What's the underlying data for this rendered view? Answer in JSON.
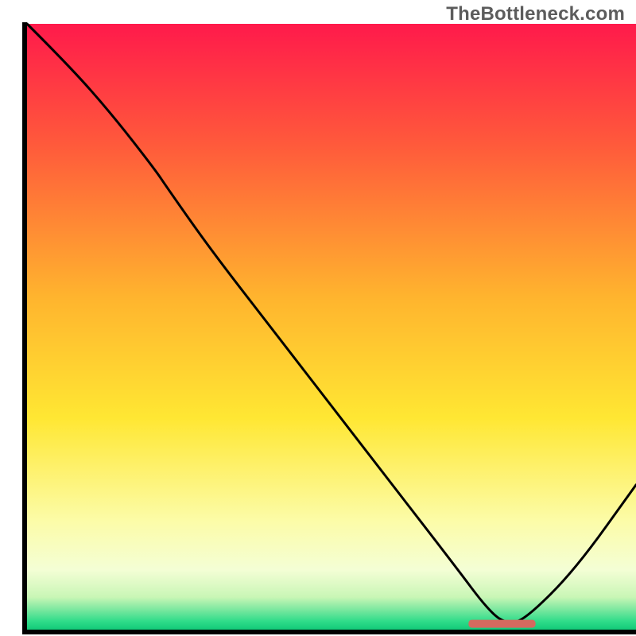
{
  "watermark": "TheBottleneck.com",
  "chart_data": {
    "type": "line",
    "title": "",
    "xlabel": "",
    "ylabel": "",
    "xlim": [
      0,
      100
    ],
    "ylim": [
      0,
      100
    ],
    "grid": false,
    "legend": false,
    "annotations": [],
    "background": {
      "type": "vertical_gradient",
      "stops": [
        {
          "pos": 0.0,
          "color": "#ff1a4b"
        },
        {
          "pos": 0.2,
          "color": "#ff5a3b"
        },
        {
          "pos": 0.45,
          "color": "#ffb42e"
        },
        {
          "pos": 0.65,
          "color": "#ffe733"
        },
        {
          "pos": 0.82,
          "color": "#fcfca8"
        },
        {
          "pos": 0.9,
          "color": "#f4fed5"
        },
        {
          "pos": 0.945,
          "color": "#c9f6b6"
        },
        {
          "pos": 0.965,
          "color": "#7ee8a0"
        },
        {
          "pos": 0.985,
          "color": "#2fdc8a"
        },
        {
          "pos": 1.0,
          "color": "#10c877"
        }
      ]
    },
    "series": [
      {
        "name": "bottleneck-curve",
        "color": "#000000",
        "stroke_width": 3,
        "x": [
          0,
          7,
          14,
          21,
          23,
          30,
          40,
          50,
          60,
          70,
          76,
          79,
          82,
          90,
          100
        ],
        "y": [
          100,
          93,
          85,
          76,
          73,
          63,
          50,
          37,
          24,
          11,
          3,
          1,
          2,
          10,
          24
        ]
      }
    ],
    "marker": {
      "name": "optimal-range",
      "shape": "rounded-rect",
      "color": "#d46a5f",
      "x_center": 78,
      "y": 1.1,
      "width": 11,
      "height": 1.3
    }
  }
}
